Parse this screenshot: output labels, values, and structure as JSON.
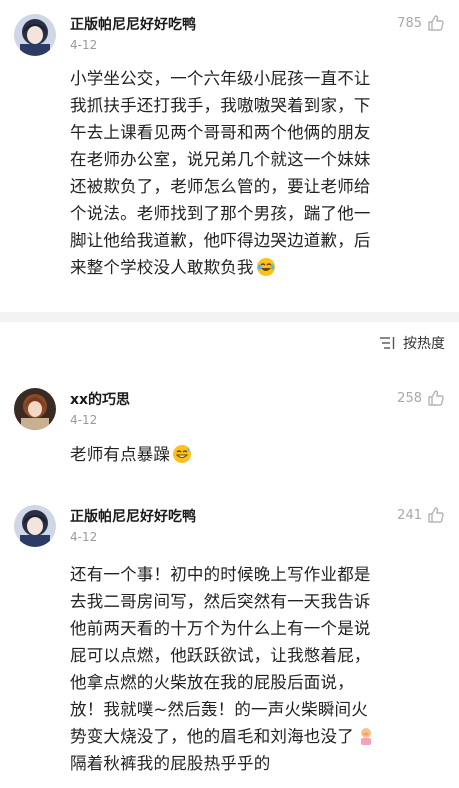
{
  "comments": [
    {
      "author": "正版帕尼尼好好吃鸭",
      "date": "4-12",
      "likes": "785",
      "lines": [
        "小学坐公交，一个六年级小屁孩一直不让",
        "我抓扶手还打我手，我嗷嗷哭着到家，下",
        "午去上课看见两个哥哥和两个他俩的朋友",
        "在老师办公室，说兄弟几个就这一个妹妹",
        "还被欺负了，老师怎么管的，要让老师给",
        "个说法。老师找到了那个男孩，踹了他一",
        "脚让他给我道歉，他吓得边哭边道歉，后",
        "来整个学校没人敢欺负我"
      ],
      "trailing_emoji": "laugh-cry-emoji"
    },
    {
      "author": "xx的巧思",
      "date": "4-12",
      "likes": "258",
      "lines": [
        "老师有点暴躁"
      ],
      "trailing_emoji": "grin-sweat-emoji"
    },
    {
      "author": "正版帕尼尼好好吃鸭",
      "date": "4-12",
      "likes": "241",
      "lines": [
        "还有一个事！初中的时候晚上写作业都是",
        "去我二哥房间写，然后突然有一天我告诉",
        "他前两天看的十万个为什么上有一个是说",
        "屁可以点燃，他跃跃欲试，让我憋着屁，",
        "他拿点燃的火柴放在我的屁股后面说，",
        "放！我就噗~然后轰！的一声火柴瞬间火",
        "势变大烧没了，他的眉毛和刘海也没了",
        "隔着秋裤我的屁股热乎乎的"
      ],
      "trailing_emoji": "facepalm-emoji"
    }
  ],
  "sort": {
    "label": "按热度"
  },
  "colors": {
    "accent_text": "#222222",
    "muted": "#9a9a9a",
    "divider": "#f3f3f3"
  }
}
